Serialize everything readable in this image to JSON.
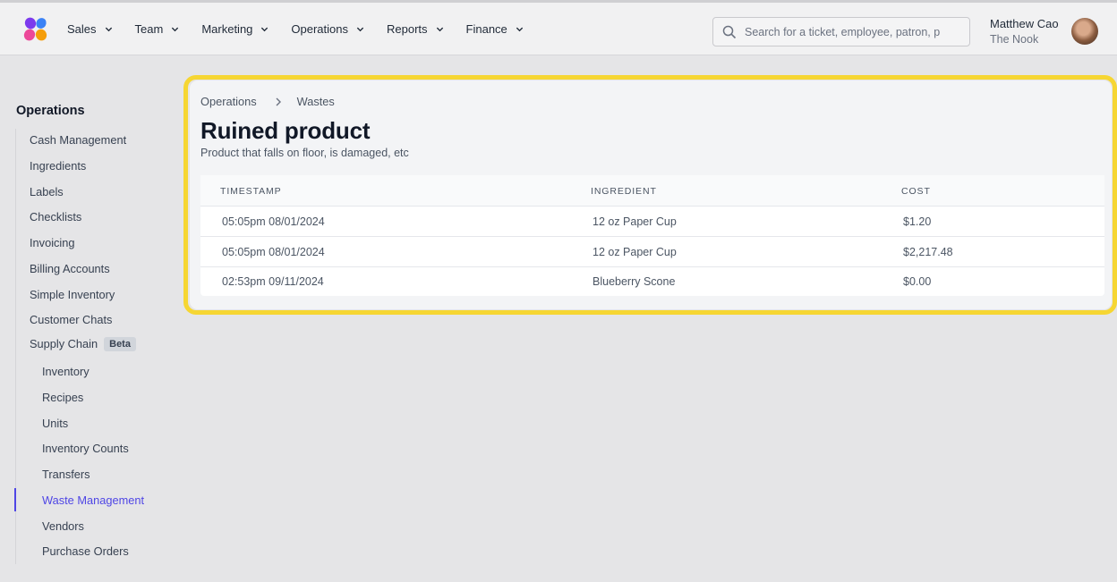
{
  "nav": {
    "items": [
      {
        "label": "Sales"
      },
      {
        "label": "Team"
      },
      {
        "label": "Marketing"
      },
      {
        "label": "Operations"
      },
      {
        "label": "Reports"
      },
      {
        "label": "Finance"
      }
    ],
    "search_placeholder": "Search for a ticket, employee, patron, p",
    "user_name": "Matthew Cao",
    "user_org": "The Nook"
  },
  "sidebar": {
    "title": "Operations",
    "items": [
      {
        "label": "Cash Management"
      },
      {
        "label": "Ingredients"
      },
      {
        "label": "Labels"
      },
      {
        "label": "Checklists"
      },
      {
        "label": "Invoicing"
      },
      {
        "label": "Billing Accounts"
      },
      {
        "label": "Simple Inventory"
      },
      {
        "label": "Customer Chats"
      },
      {
        "label": "Supply Chain",
        "badge": "Beta"
      }
    ],
    "subitems": [
      {
        "label": "Inventory"
      },
      {
        "label": "Recipes"
      },
      {
        "label": "Units"
      },
      {
        "label": "Inventory Counts"
      },
      {
        "label": "Transfers"
      },
      {
        "label": "Waste Management",
        "active": true
      },
      {
        "label": "Vendors"
      },
      {
        "label": "Purchase Orders"
      }
    ]
  },
  "main": {
    "breadcrumb": [
      "Operations",
      "Wastes"
    ],
    "title": "Ruined product",
    "subtitle": "Product that falls on floor, is damaged, etc",
    "table": {
      "headers": [
        "TIMESTAMP",
        "INGREDIENT",
        "COST"
      ],
      "rows": [
        [
          "05:05pm 08/01/2024",
          "12 oz Paper Cup",
          "$1.20"
        ],
        [
          "05:05pm 08/01/2024",
          "12 oz Paper Cup",
          "$2,217.48"
        ],
        [
          "02:53pm 09/11/2024",
          "Blueberry Scone",
          "$0.00"
        ]
      ]
    }
  },
  "colors": {
    "accent": "#4f46e5",
    "highlight": "#f6d633"
  }
}
